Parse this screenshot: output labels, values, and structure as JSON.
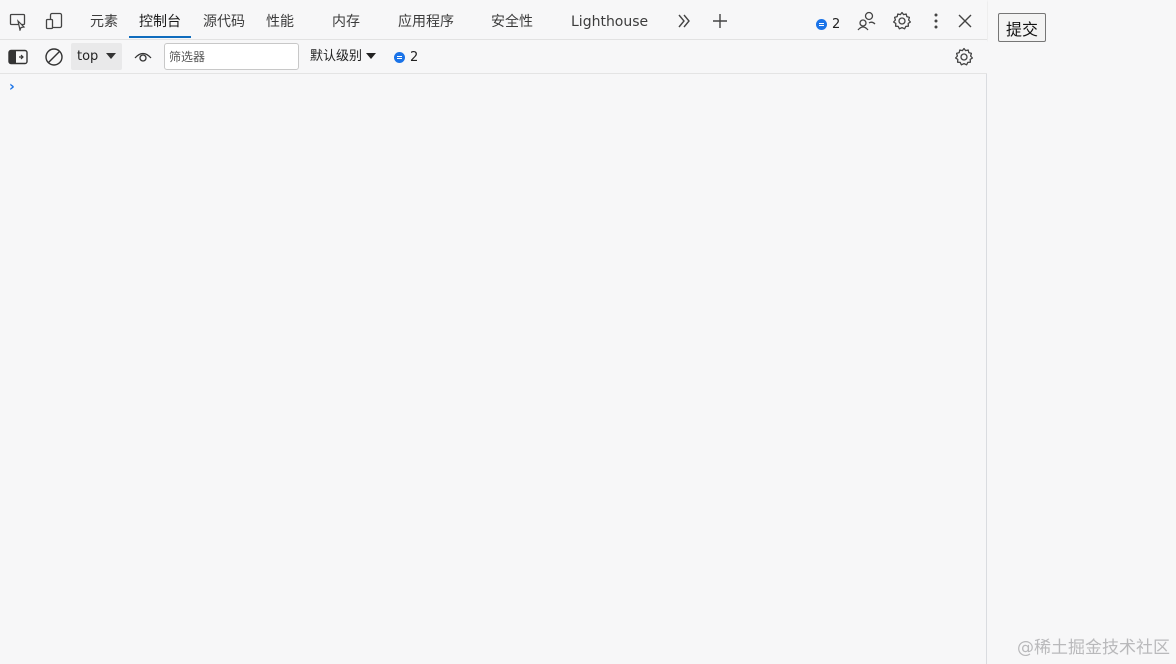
{
  "tabbar": {
    "tabs": [
      {
        "label": "元素"
      },
      {
        "label": "控制台"
      },
      {
        "label": "源代码"
      },
      {
        "label": "性能"
      },
      {
        "label": "内存"
      },
      {
        "label": "应用程序"
      },
      {
        "label": "安全性"
      },
      {
        "label": "Lighthouse"
      }
    ],
    "active_tab": "控制台",
    "issues_count": "2"
  },
  "toolbar": {
    "context": "top",
    "filter_placeholder": "筛选器",
    "filter_value": "",
    "level_label": "默认级别",
    "issues_count": "2"
  },
  "console": {
    "prompt": "›"
  },
  "page": {
    "submit_label": "提交"
  },
  "watermark": "@稀土掘金技术社区",
  "colors": {
    "accent": "#0f6cbd",
    "issue_badge": "#1a73e8",
    "background": "#f7f7f8"
  },
  "icons": [
    "inspect-element-icon",
    "device-toolbar-icon",
    "more-tabs-icon",
    "add-tab-icon",
    "issues-icon",
    "customize-icon",
    "settings-icon",
    "more-options-icon",
    "close-icon",
    "sidebar-toggle-icon",
    "clear-console-icon",
    "live-expression-icon",
    "console-settings-icon"
  ]
}
